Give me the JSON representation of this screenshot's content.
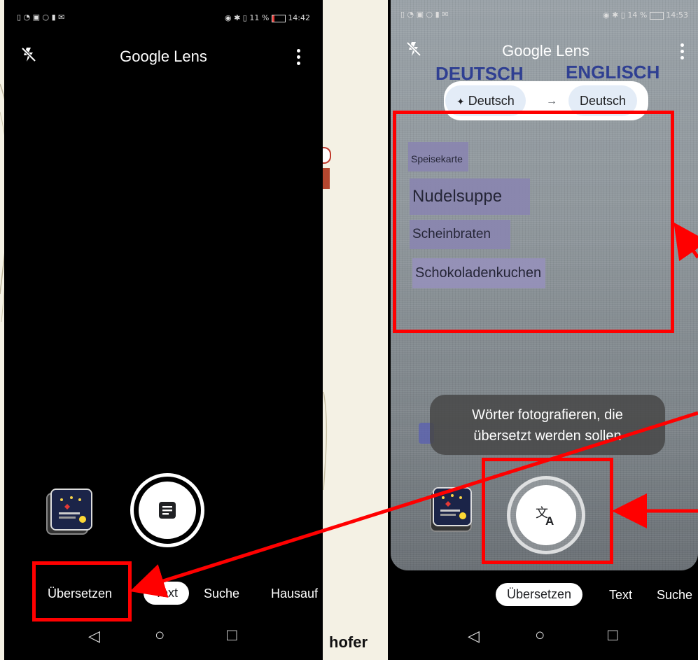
{
  "slide": {
    "footer_text": "hofer"
  },
  "left_phone": {
    "status_time": "14:42",
    "status_battery": "11 %",
    "title": "Google Lens",
    "active_shutter_icon": "text-lines-icon",
    "modes": [
      "Übersetzen",
      "Text",
      "Suche",
      "Hausauf"
    ],
    "active_mode": "Text",
    "nav": [
      "◁",
      "○",
      "□"
    ]
  },
  "right_phone": {
    "status_time": "14:53",
    "status_battery": "14 %",
    "title": "Google Lens",
    "paper_heading_left": "DEUTSCH",
    "paper_heading_right": "ENGLISCH",
    "source_language": "Deutsch",
    "target_language": "Deutsch",
    "language_arrow": "→",
    "menu_items": [
      "Speisekarte",
      "Nudelsuppe",
      "Scheinbraten",
      "Schokoladenkuchen"
    ],
    "hint_line1": "Wörter fotografieren, die",
    "hint_line2": "übersetzt werden sollen",
    "modes": [
      "Übersetzen",
      "Text",
      "Suche"
    ],
    "active_mode": "Übersetzen",
    "shutter_icon": "translate-icon",
    "nav": [
      "◁",
      "○",
      "□"
    ]
  },
  "colors": {
    "annotation": "#ff0000",
    "chip_bg": "#e3ecf7",
    "paper_heading": "#2f3f92"
  }
}
